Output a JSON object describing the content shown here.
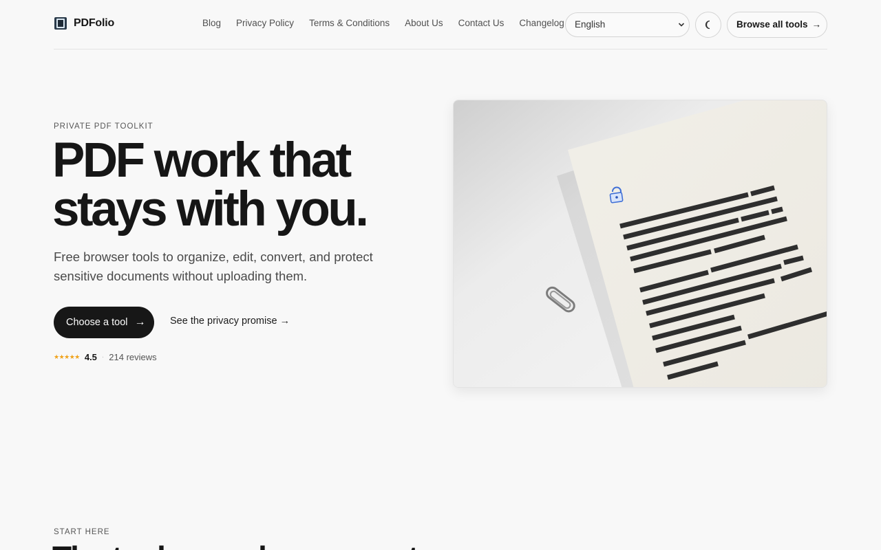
{
  "brand": {
    "name": "PDFolio"
  },
  "nav": {
    "links": [
      "Blog",
      "Privacy Policy",
      "Terms & Conditions",
      "About Us",
      "Contact Us",
      "Changelog"
    ]
  },
  "language": {
    "selected": "English"
  },
  "theme_toggle": {
    "icon": "moon-icon"
  },
  "browse": {
    "label": "Browse all tools",
    "arrow": "→"
  },
  "hero": {
    "eyebrow": "PRIVATE PDF TOOLKIT",
    "title_line1": "PDF work that",
    "title_line2": "stays with you.",
    "subtitle": "Free browser tools to organize, edit, convert, and protect sensitive documents without uploading them.",
    "cta_label": "Choose a tool",
    "cta_arrow": "→",
    "privacy_link": "See the privacy promise →",
    "rating": {
      "stars": "★★★★★",
      "score": "4.5",
      "reviews": "214 reviews"
    }
  },
  "section": {
    "eyebrow": "START HERE",
    "title": "The tools people use most"
  },
  "colors": {
    "accent": "#171717",
    "star": "#f0a21a",
    "background": "#f8f8f8"
  }
}
